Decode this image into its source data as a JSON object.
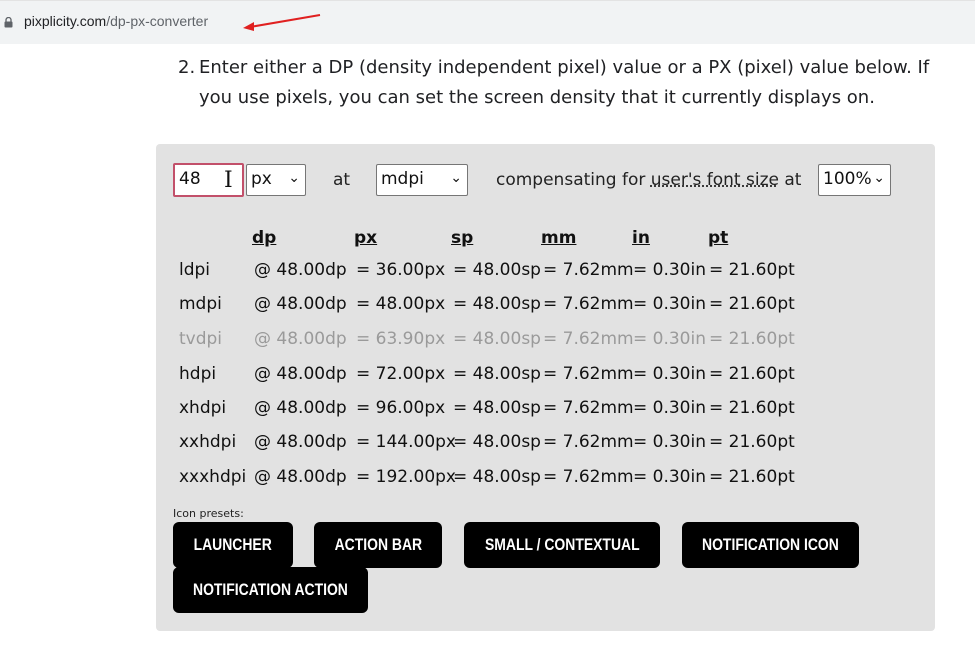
{
  "browser": {
    "url_host": "pixplicity.com",
    "url_path": "/dp-px-converter"
  },
  "instruction": {
    "number": "2.",
    "text": "Enter either a DP (density independent pixel) value or a PX (pixel) value below. If you use pixels, you can set the screen density that it currently displays on."
  },
  "converter": {
    "input_value": "48",
    "unit_select": "px",
    "at_label": "at",
    "density_select": "mdpi",
    "compensating_label": "compensating for",
    "font_size_link": "user's font size",
    "at_label_2": "at",
    "font_scale_select": "100%",
    "headers": [
      "dp",
      "px",
      "sp",
      "mm",
      "in",
      "pt"
    ],
    "rows": [
      {
        "density": "ldpi",
        "dp": "@ 48.00dp",
        "px": "= 36.00px",
        "sp": "= 48.00sp",
        "mm": "= 7.62mm",
        "in": "= 0.30in",
        "pt": "= 21.60pt",
        "dim": false
      },
      {
        "density": "mdpi",
        "dp": "@ 48.00dp",
        "px": "= 48.00px",
        "sp": "= 48.00sp",
        "mm": "= 7.62mm",
        "in": "= 0.30in",
        "pt": "= 21.60pt",
        "dim": false
      },
      {
        "density": "tvdpi",
        "dp": "@ 48.00dp",
        "px": "= 63.90px",
        "sp": "= 48.00sp",
        "mm": "= 7.62mm",
        "in": "= 0.30in",
        "pt": "= 21.60pt",
        "dim": true
      },
      {
        "density": "hdpi",
        "dp": "@ 48.00dp",
        "px": "= 72.00px",
        "sp": "= 48.00sp",
        "mm": "= 7.62mm",
        "in": "= 0.30in",
        "pt": "= 21.60pt",
        "dim": false
      },
      {
        "density": "xhdpi",
        "dp": "@ 48.00dp",
        "px": "= 96.00px",
        "sp": "= 48.00sp",
        "mm": "= 7.62mm",
        "in": "= 0.30in",
        "pt": "= 21.60pt",
        "dim": false
      },
      {
        "density": "xxhdpi",
        "dp": "@ 48.00dp",
        "px": "= 144.00px",
        "sp": "= 48.00sp",
        "mm": "= 7.62mm",
        "in": "= 0.30in",
        "pt": "= 21.60pt",
        "dim": false
      },
      {
        "density": "xxxhdpi",
        "dp": "@ 48.00dp",
        "px": "= 192.00px",
        "sp": "= 48.00sp",
        "mm": "= 7.62mm",
        "in": "= 0.30in",
        "pt": "= 21.60pt",
        "dim": false
      }
    ],
    "presets_label": "Icon presets:",
    "presets": [
      "LAUNCHER",
      "ACTION BAR",
      "SMALL / CONTEXTUAL",
      "NOTIFICATION ICON",
      "NOTIFICATION ACTION"
    ]
  },
  "colors": {
    "annotation_arrow": "#e02020",
    "panel_bg": "#e2e2e2",
    "input_border": "#c2506a",
    "dim_text": "#9a9a9a"
  },
  "icons": {
    "lock": "lock-icon",
    "cursor": "text-cursor-icon",
    "dropdown": "chevron-down-icon"
  }
}
